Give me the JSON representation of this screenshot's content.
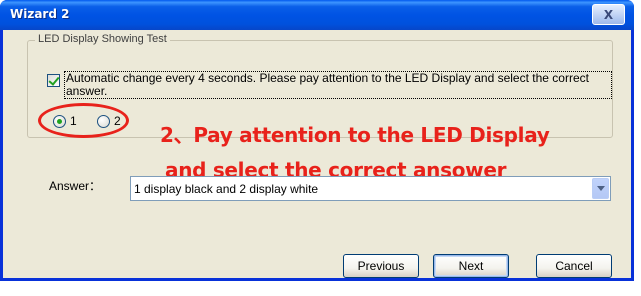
{
  "window": {
    "title": "Wizard 2",
    "close_glyph": "X"
  },
  "group": {
    "legend": "LED Display Showing Test",
    "auto_change_checked": true,
    "auto_change_text": "Automatic change every 4 seconds. Please pay attention to the LED Display and select the correct answer.",
    "radios": [
      {
        "label": "1",
        "checked": true
      },
      {
        "label": "2",
        "checked": false
      }
    ]
  },
  "answer": {
    "label": "Answer：",
    "value": "1 display black and 2 display white"
  },
  "annotation": {
    "line1": "2、Pay attention to the LED Display",
    "line2": "and select the correct ansower",
    "color": "#e8221b"
  },
  "buttons": {
    "previous": "Previous",
    "next": "Next",
    "cancel": "Cancel"
  }
}
